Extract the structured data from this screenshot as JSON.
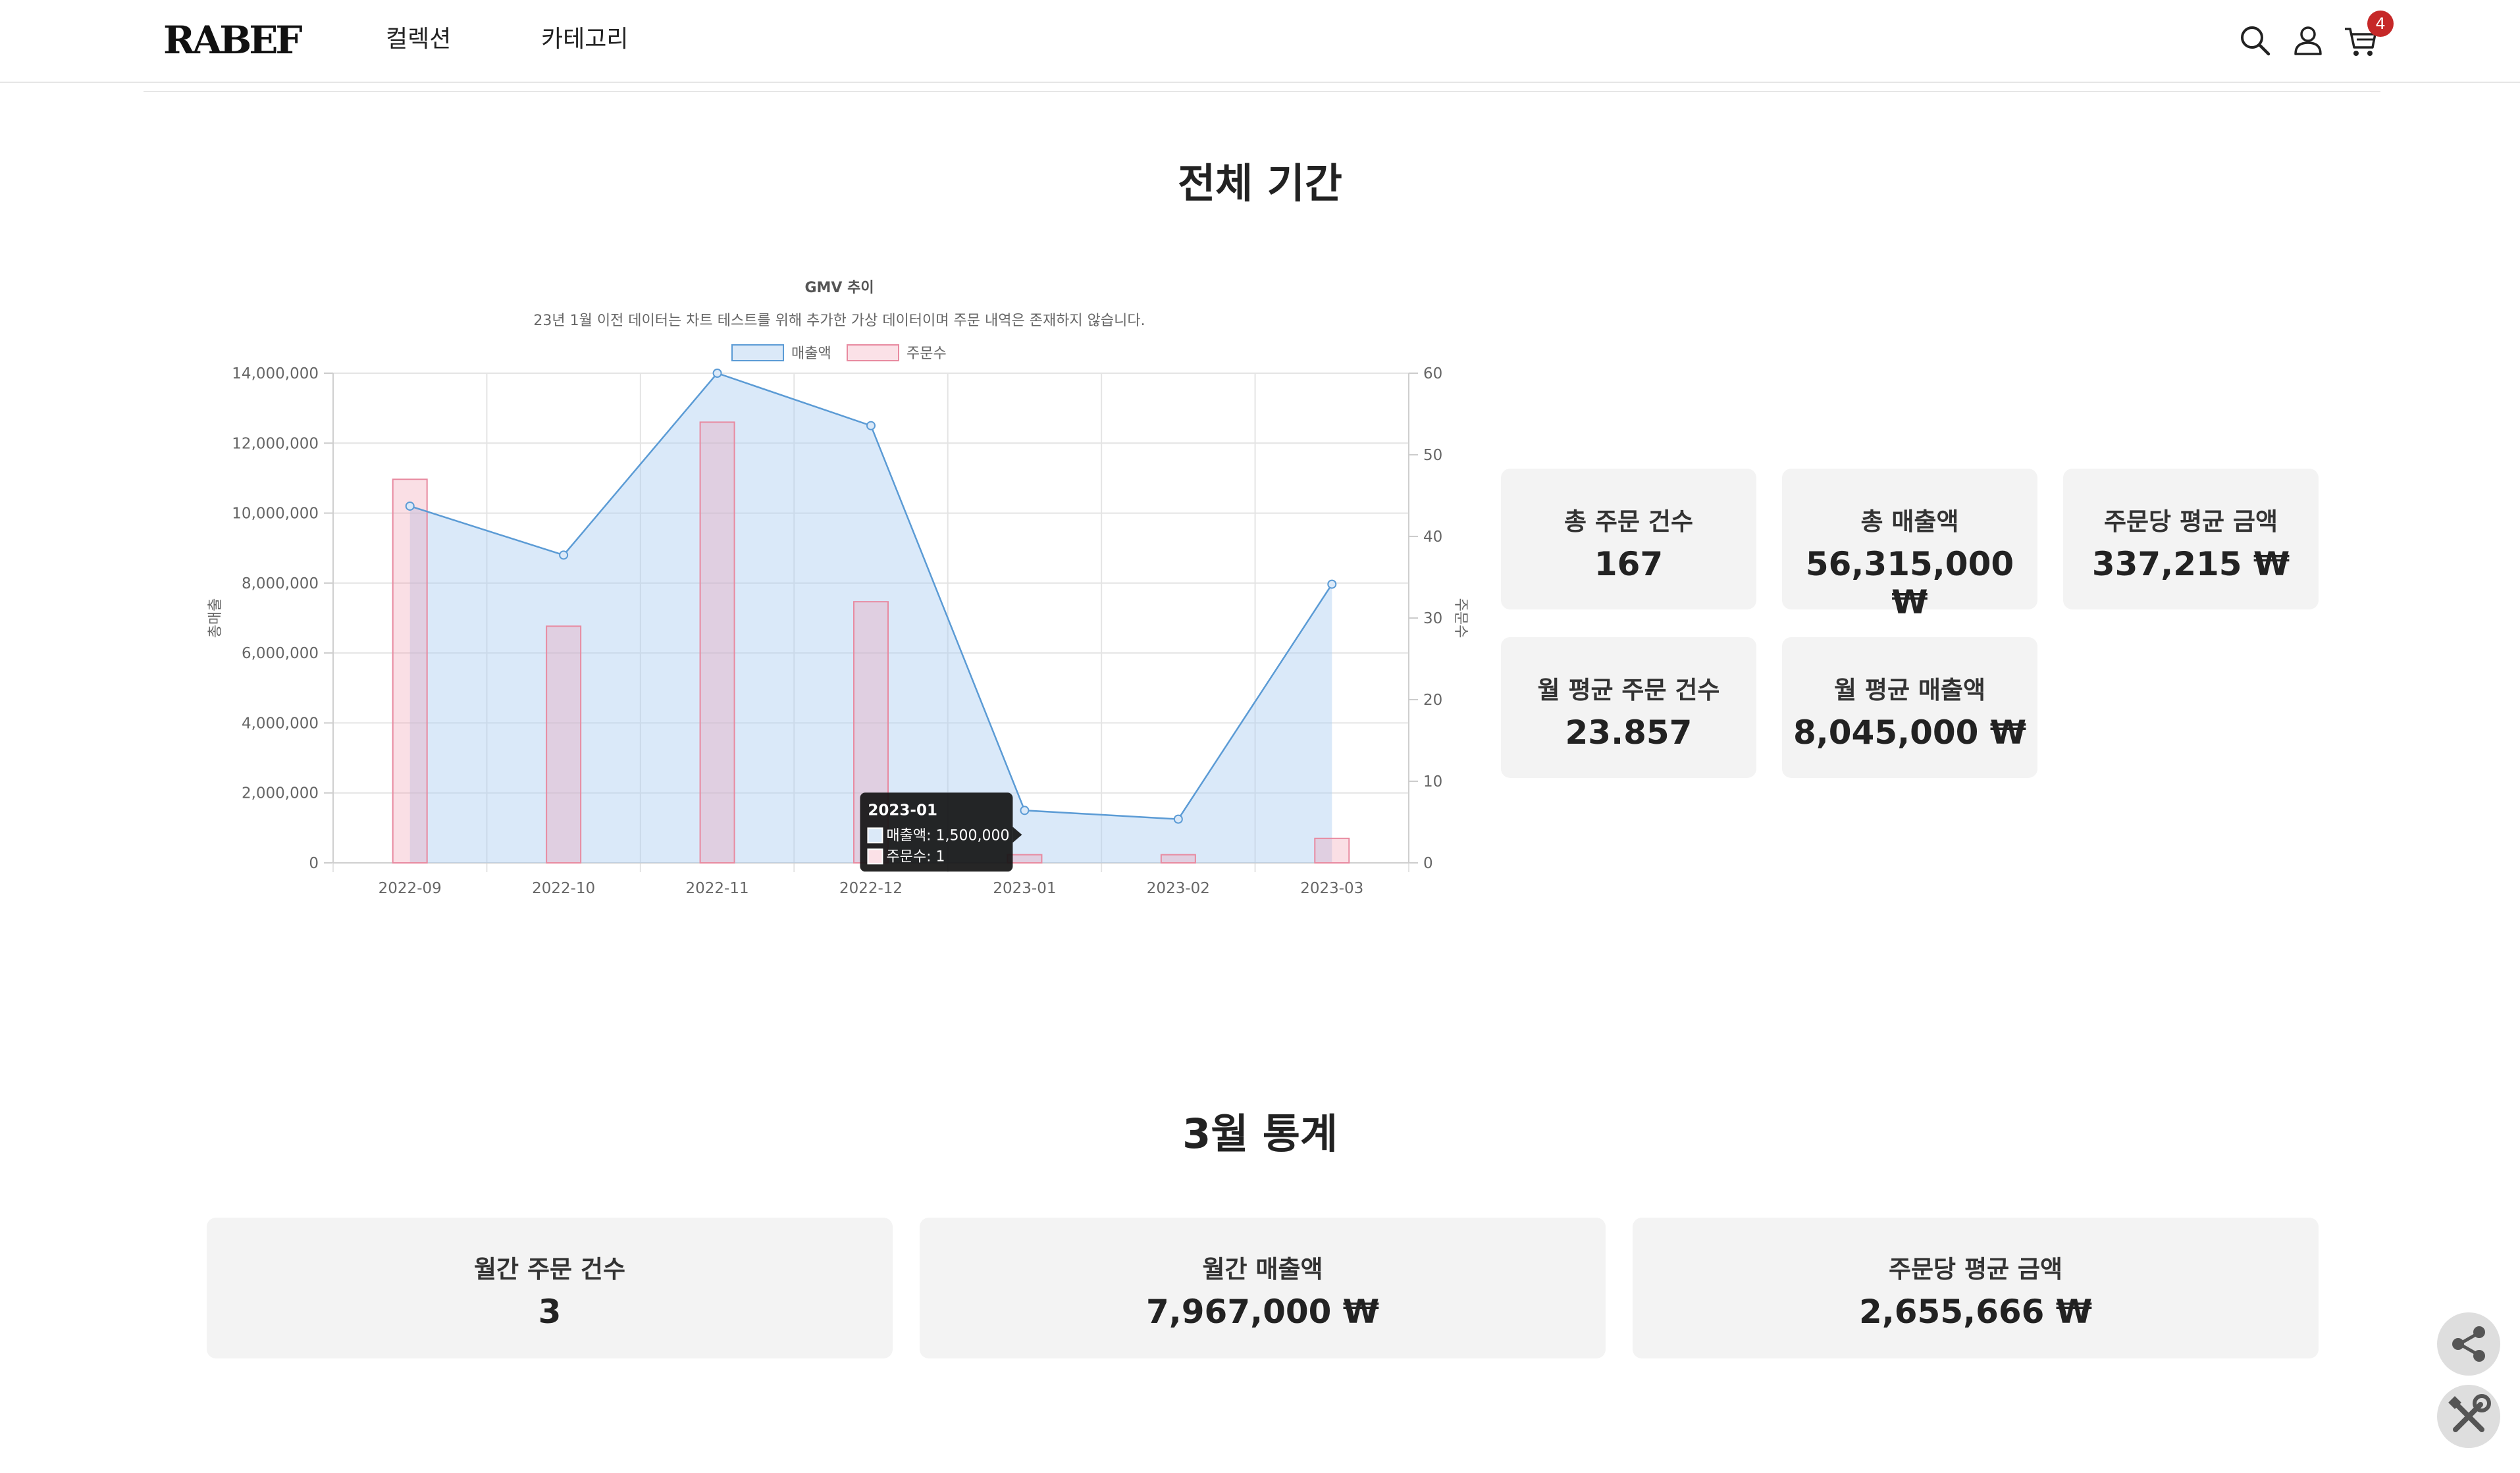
{
  "header": {
    "logo": "RABEF",
    "nav": [
      "컬렉션",
      "카테고리"
    ],
    "icons": [
      "search-icon",
      "user-icon",
      "cart-icon"
    ],
    "cart_count": "4"
  },
  "overall": {
    "title": "전체 기간",
    "stats": [
      {
        "label": "총 주문 건수",
        "value": "167"
      },
      {
        "label": "총 매출액",
        "value": "56,315,000 ₩"
      },
      {
        "label": "주문당 평균 금액",
        "value": "337,215 ₩"
      },
      {
        "label": "월 평균 주문 건수",
        "value": "23.857"
      },
      {
        "label": "월 평균 매출액",
        "value": "8,045,000 ₩"
      }
    ]
  },
  "chart_data": {
    "type": "line+bar",
    "title": "GMV 추이",
    "subtitle": "23년 1월 이전 데이터는 차트 테스트를 위해 추가한 가상 데이터이며 주문 내역은 존재하지 않습니다.",
    "categories": [
      "2022-09",
      "2022-10",
      "2022-11",
      "2022-12",
      "2023-01",
      "2023-02",
      "2023-03"
    ],
    "series": [
      {
        "name": "매출액",
        "type": "area",
        "axis": "left",
        "values": [
          10200000,
          8800000,
          14000000,
          12500000,
          1500000,
          1250000,
          7967000
        ],
        "color": "#5b9bd5"
      },
      {
        "name": "주문수",
        "type": "bar",
        "axis": "right",
        "values": [
          47,
          29,
          54,
          32,
          1,
          1,
          3
        ],
        "color": "#e88aa0"
      }
    ],
    "ylabel_left": "총매출",
    "ylabel_right": "주문수",
    "ylim_left": [
      0,
      14000000
    ],
    "ylim_right": [
      0,
      60
    ],
    "yticks_left": [
      "0",
      "2,000,000",
      "4,000,000",
      "6,000,000",
      "8,000,000",
      "10,000,000",
      "12,000,000",
      "14,000,000"
    ],
    "yticks_right": [
      "0",
      "10",
      "20",
      "30",
      "40",
      "50",
      "60"
    ],
    "legend_position": "top",
    "grid": true,
    "tooltip": {
      "title": "2023-01",
      "lines": [
        "매출액: 1,500,000",
        "주문수: 1"
      ]
    }
  },
  "monthly": {
    "title": "3월 통계",
    "stats": [
      {
        "label": "월간 주문 건수",
        "value": "3"
      },
      {
        "label": "월간 매출액",
        "value": "7,967,000 ₩"
      },
      {
        "label": "주문당 평균 금액",
        "value": "2,655,666 ₩"
      }
    ]
  },
  "fabs": [
    "share-icon",
    "tools-icon"
  ]
}
